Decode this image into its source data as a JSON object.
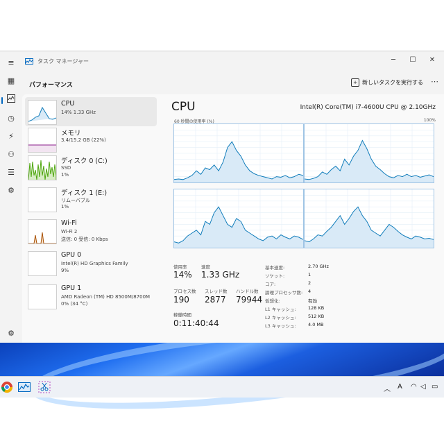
{
  "window": {
    "title": "タスク マネージャー"
  },
  "header": {
    "page_title": "パフォーマンス",
    "new_task_label": "新しいタスクを実行する"
  },
  "sidebar": {
    "items": [
      {
        "name": "CPU",
        "sub1": "14%  1.33 GHz",
        "sub2": "",
        "sub3": ""
      },
      {
        "name": "メモリ",
        "sub1": "3.4/15.2 GB (22%)",
        "sub2": "",
        "sub3": ""
      },
      {
        "name": "ディスク 0 (C:)",
        "sub1": "SSD",
        "sub2": "1%",
        "sub3": ""
      },
      {
        "name": "ディスク 1 (E:)",
        "sub1": "リムーバブル",
        "sub2": "1%",
        "sub3": ""
      },
      {
        "name": "Wi-Fi",
        "sub1": "Wi-Fi 2",
        "sub2": "送信: 0 受信: 0 Kbps",
        "sub3": ""
      },
      {
        "name": "GPU 0",
        "sub1": "Intel(R) HD Graphics Family",
        "sub2": "9%",
        "sub3": ""
      },
      {
        "name": "GPU 1",
        "sub1": "AMD Radeon (TM) HD 8500M/8700M",
        "sub2": "0% (34 °C)",
        "sub3": ""
      }
    ]
  },
  "main": {
    "title": "CPU",
    "model": "Intel(R) Core(TM) i7-4600U CPU @ 2.10GHz",
    "axis_left": "60 秒間の使用率 (%)",
    "axis_right": "100%",
    "utilization_label": "使用率",
    "utilization_value": "14%",
    "speed_label": "速度",
    "speed_value": "1.33 GHz",
    "process_label": "プロセス数",
    "process_value": "190",
    "thread_label": "スレッド数",
    "thread_value": "2877",
    "handle_label": "ハンドル数",
    "handle_value": "79944",
    "uptime_label": "稼働時間",
    "uptime_value": "0:11:40:44",
    "details": [
      {
        "label": "基本速度:",
        "value": "2.70 GHz"
      },
      {
        "label": "ソケット:",
        "value": "1"
      },
      {
        "label": "コア:",
        "value": "2"
      },
      {
        "label": "論理プロセッサ数:",
        "value": "4"
      },
      {
        "label": "仮想化:",
        "value": "有効"
      },
      {
        "label": "L1 キャッシュ:",
        "value": "128 KB"
      },
      {
        "label": "L2 キャッシュ:",
        "value": "512 KB"
      },
      {
        "label": "L3 キャッシュ:",
        "value": "4.0 MB"
      }
    ]
  },
  "graphs": [
    [
      5,
      6,
      5,
      8,
      12,
      20,
      14,
      25,
      22,
      30,
      20,
      35,
      60,
      70,
      55,
      45,
      30,
      20,
      15,
      12,
      10,
      8,
      6,
      10,
      9,
      12,
      8,
      10,
      14,
      12
    ],
    [
      6,
      5,
      7,
      10,
      18,
      14,
      22,
      28,
      20,
      40,
      30,
      45,
      55,
      72,
      58,
      40,
      28,
      22,
      15,
      10,
      8,
      12,
      10,
      14,
      10,
      12,
      9,
      11,
      13,
      10
    ],
    [
      10,
      8,
      12,
      20,
      25,
      30,
      22,
      45,
      40,
      60,
      70,
      55,
      40,
      35,
      50,
      45,
      30,
      25,
      20,
      15,
      12,
      18,
      20,
      15,
      22,
      18,
      15,
      20,
      18,
      14
    ],
    [
      12,
      10,
      15,
      22,
      20,
      28,
      35,
      45,
      55,
      40,
      50,
      62,
      70,
      55,
      45,
      30,
      25,
      20,
      30,
      40,
      35,
      28,
      22,
      18,
      15,
      20,
      18,
      15,
      16,
      14
    ]
  ],
  "colors": {
    "accent": "#0067c0",
    "graph_line": "#117dbb",
    "graph_fill": "#d9eaf7"
  }
}
